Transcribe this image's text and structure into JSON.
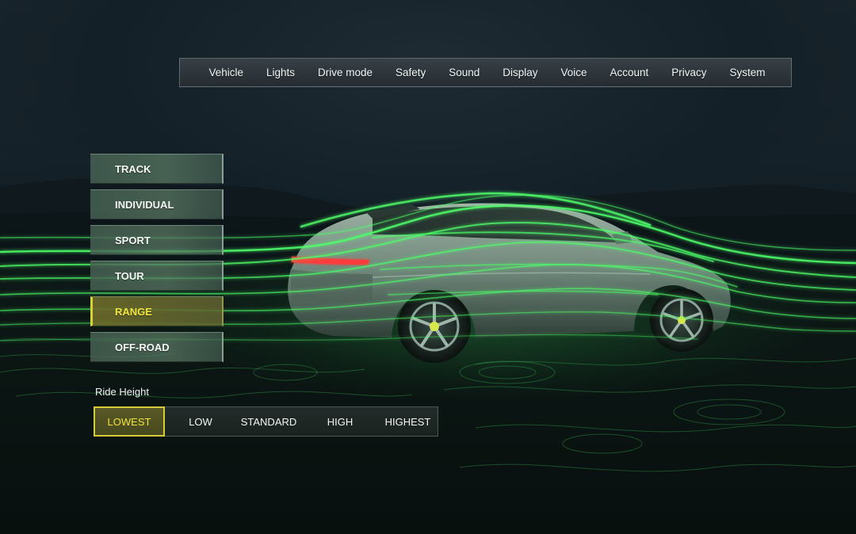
{
  "top_nav": {
    "items": [
      "Vehicle",
      "Lights",
      "Drive mode",
      "Safety",
      "Sound",
      "Display",
      "Voice",
      "Account",
      "Privacy",
      "System"
    ]
  },
  "drive_modes": {
    "items": [
      "TRACK",
      "INDIVIDUAL",
      "SPORT",
      "TOUR",
      "RANGE",
      "OFF-ROAD"
    ],
    "selected": "RANGE"
  },
  "ride_height": {
    "label": "Ride Height",
    "options": [
      "LOWEST",
      "LOW",
      "STANDARD",
      "HIGH",
      "HIGHEST"
    ],
    "selected": "LOWEST"
  },
  "colors": {
    "accent_yellow": "#d8d23c",
    "flow_green": "#4dff6a"
  }
}
